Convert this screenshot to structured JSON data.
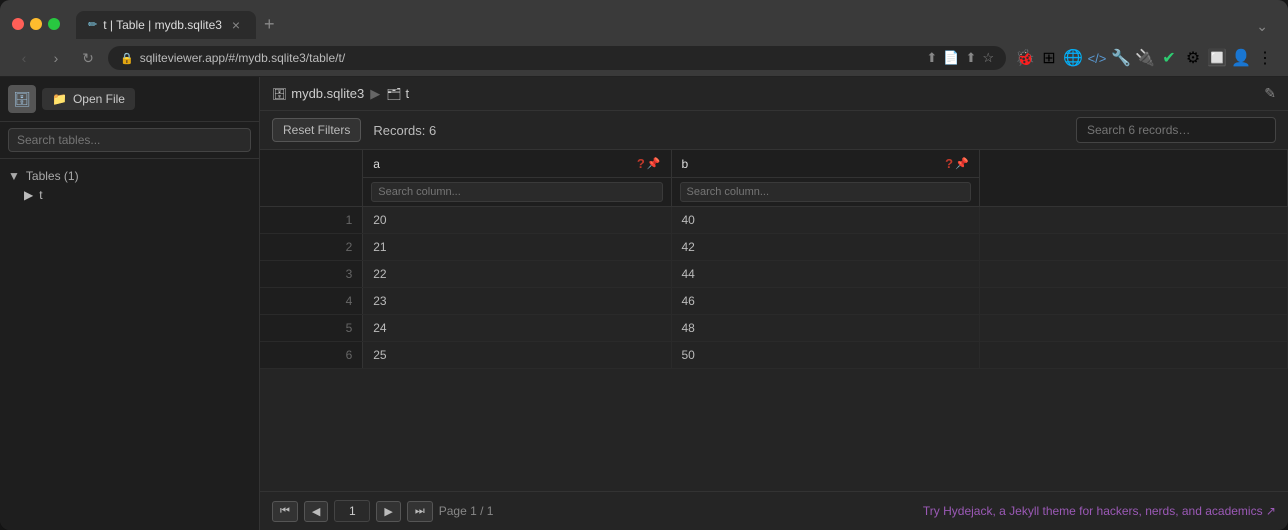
{
  "browser": {
    "tab": {
      "icon": "✏",
      "title": "t | Table | mydb.sqlite3",
      "close_label": "×"
    },
    "new_tab_label": "+",
    "more_label": "⌄",
    "address": "sqliteviewer.app/#/mydb.sqlite3/table/t/",
    "nav": {
      "back_label": "‹",
      "forward_label": "›",
      "refresh_label": "↻"
    },
    "toolbar_icons": [
      "⬆",
      "📄",
      "⬆",
      "☆",
      "🐞",
      "⊞",
      "🌐",
      "⋯",
      "🔧",
      "🔌",
      "📋",
      "⚙",
      "🔲",
      "👤",
      "⋮"
    ]
  },
  "sidebar": {
    "open_file_btn": "📁 Open File",
    "search_placeholder": "Search tables...",
    "tables_section": {
      "header": "Tables (1)",
      "items": [
        {
          "name": "t"
        }
      ]
    },
    "sidebar_icon": "🔍"
  },
  "main": {
    "breadcrumb": {
      "db_name": "mydb.sqlite3",
      "separator": "▶",
      "table_name": "t"
    },
    "pencil_label": "✎",
    "reset_filters_label": "Reset Filters",
    "records_count": "Records: 6",
    "search_placeholder": "Search 6 records…",
    "columns": [
      {
        "name": "a",
        "question_icon": "?",
        "pin_icon": "📌"
      },
      {
        "name": "b",
        "question_icon": "?",
        "pin_icon": "📌"
      }
    ],
    "column_search_placeholder": "Search column...",
    "rows": [
      {
        "num": 1,
        "a": 20,
        "b": 40
      },
      {
        "num": 2,
        "a": 21,
        "b": 42
      },
      {
        "num": 3,
        "a": 22,
        "b": 44
      },
      {
        "num": 4,
        "a": 23,
        "b": 46
      },
      {
        "num": 5,
        "a": 24,
        "b": 48
      },
      {
        "num": 6,
        "a": 25,
        "b": 50
      }
    ],
    "pagination": {
      "first_label": "⏮",
      "prev_label": "◀",
      "current_page": "1",
      "next_label": "▶",
      "last_label": "⏭",
      "page_info": "Page 1 / 1"
    },
    "promo_text": "Try Hydejack, a Jekyll theme for hackers, nerds, and academics ↗"
  },
  "colors": {
    "accent": "#9b59b6",
    "col_icon_red": "#c0392b"
  }
}
